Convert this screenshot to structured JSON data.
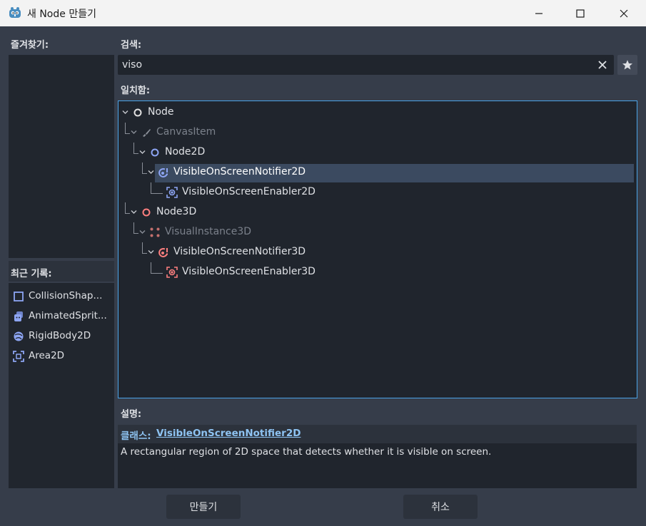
{
  "window": {
    "title": "새 Node 만들기"
  },
  "favorites": {
    "label": "즐겨찾기:"
  },
  "recent": {
    "label": "최근 기록:",
    "items": [
      {
        "label": "CollisionShap...",
        "icon": "collision-shape-icon"
      },
      {
        "label": "AnimatedSprit...",
        "icon": "animated-sprite-icon"
      },
      {
        "label": "RigidBody2D",
        "icon": "rigid-body-icon"
      },
      {
        "label": "Area2D",
        "icon": "area2d-icon"
      }
    ]
  },
  "search": {
    "label": "검색:",
    "value": "viso"
  },
  "matches": {
    "label": "일치함:",
    "tree": [
      {
        "label": "Node",
        "icon": "node-icon",
        "dim": false
      },
      {
        "label": "CanvasItem",
        "icon": "canvas-item-icon",
        "dim": true
      },
      {
        "label": "Node2D",
        "icon": "node2d-icon",
        "dim": false
      },
      {
        "label": "VisibleOnScreenNotifier2D",
        "icon": "visible-notifier-2d-icon",
        "dim": false,
        "selected": true
      },
      {
        "label": "VisibleOnScreenEnabler2D",
        "icon": "visible-enabler-2d-icon",
        "dim": false
      },
      {
        "label": "Node3D",
        "icon": "node3d-icon",
        "dim": false
      },
      {
        "label": "VisualInstance3D",
        "icon": "visual-instance-3d-icon",
        "dim": true
      },
      {
        "label": "VisibleOnScreenNotifier3D",
        "icon": "visible-notifier-3d-icon",
        "dim": false
      },
      {
        "label": "VisibleOnScreenEnabler3D",
        "icon": "visible-enabler-3d-icon",
        "dim": false
      }
    ]
  },
  "description": {
    "label": "설명:",
    "class_label": "클래스:",
    "class_name": "VisibleOnScreenNotifier2D",
    "text": "A rectangular region of 2D space that detects whether it is visible on screen."
  },
  "buttons": {
    "create": "만들기",
    "cancel": "취소"
  },
  "colors": {
    "accent": "#4aa3e8",
    "selection": "#3b4a60",
    "node2d": "#8da5f3",
    "node3d": "#fc7f7f"
  }
}
